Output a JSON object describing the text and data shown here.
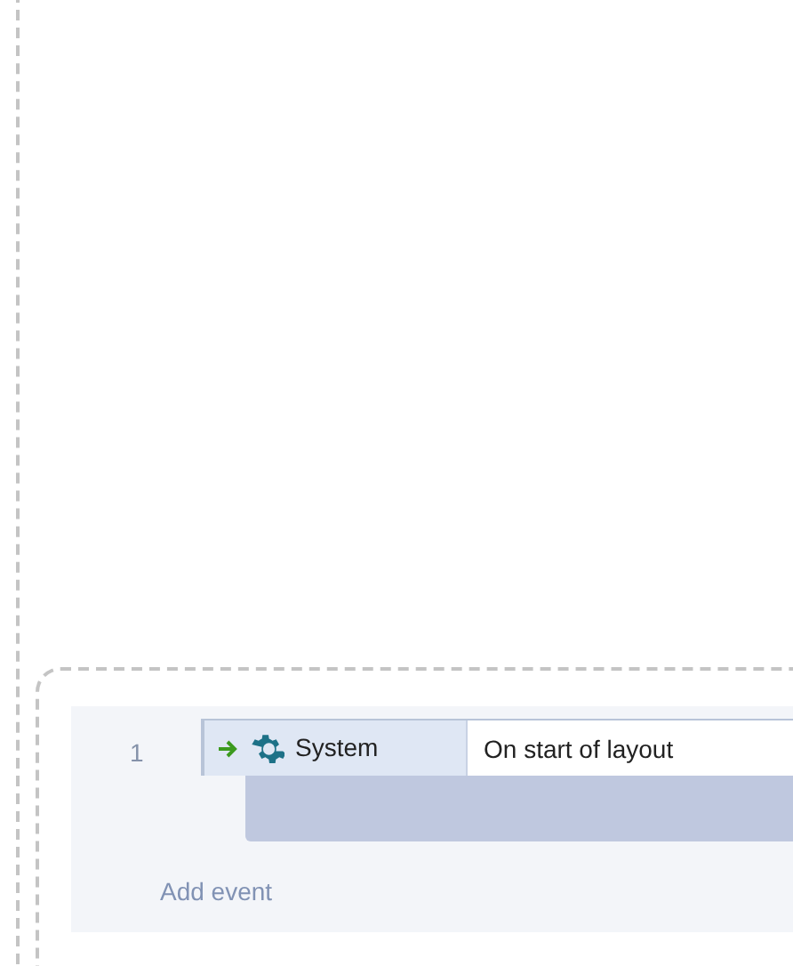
{
  "event_sheet": {
    "events": [
      {
        "number": "1",
        "conditions": [
          {
            "object": "System",
            "condition": "On start of layout"
          }
        ]
      }
    ],
    "add_event": "Add event"
  }
}
